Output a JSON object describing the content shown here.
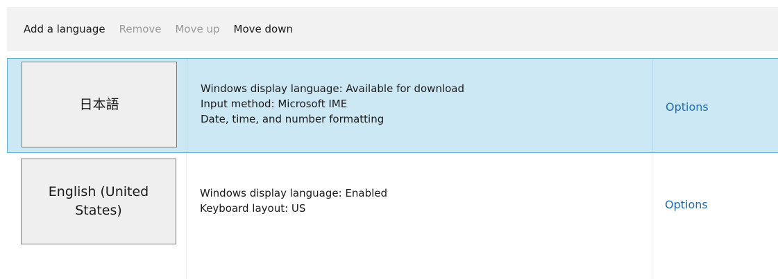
{
  "toolbar": {
    "add_label": "Add a language",
    "remove_label": "Remove",
    "move_up_label": "Move up",
    "move_down_label": "Move down"
  },
  "languages": [
    {
      "name": "日本語",
      "selected": true,
      "details": [
        "Windows display language: Available for download",
        "Input method: Microsoft IME",
        "Date, time, and number formatting"
      ],
      "options_label": "Options"
    },
    {
      "name": "English (United States)",
      "selected": false,
      "details": [
        "Windows display language: Enabled",
        "Keyboard layout: US"
      ],
      "options_label": "Options"
    }
  ],
  "colors": {
    "selected_background": "#cde8f5",
    "selected_border": "#5fb0e0",
    "link": "#1f6fb5",
    "disabled_text": "#9a9a9a",
    "toolbar_background": "#f2f2f2"
  }
}
